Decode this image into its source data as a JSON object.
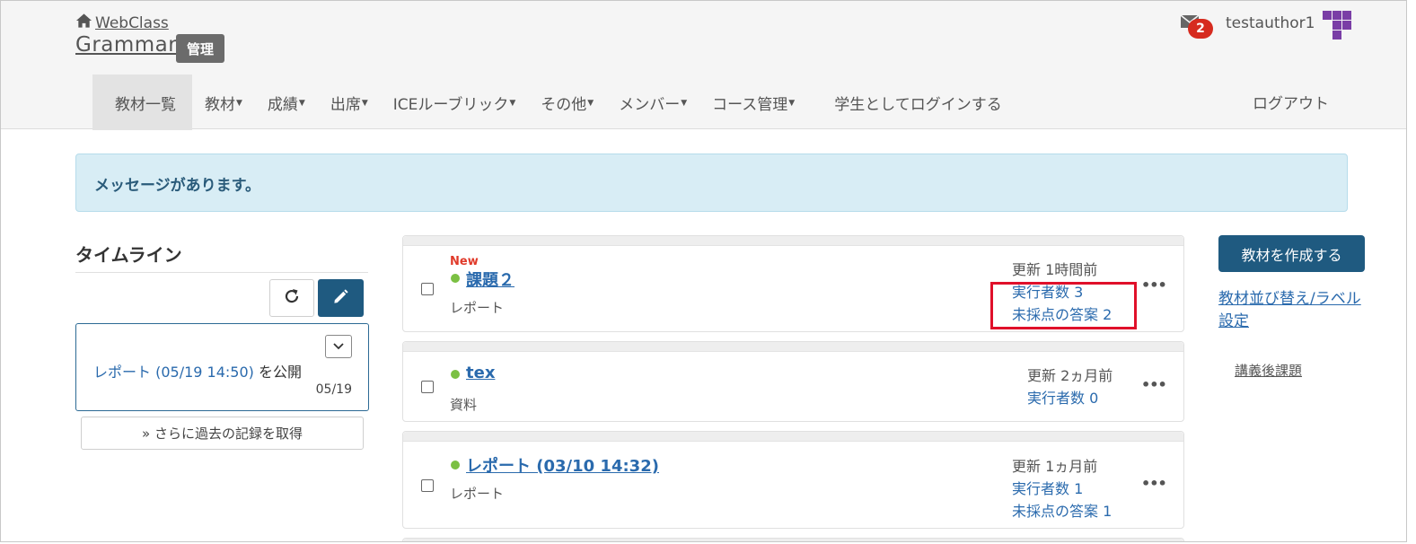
{
  "header": {
    "home_label": "WebClass",
    "course_title": "Grammar",
    "admin_badge": "管理",
    "mail_count": "2",
    "username": "testauthor1",
    "logout_label": "ログアウト"
  },
  "nav": {
    "items": [
      {
        "label": "教材一覧"
      },
      {
        "label": "教材"
      },
      {
        "label": "成績"
      },
      {
        "label": "出席"
      },
      {
        "label": "ICEルーブリック"
      },
      {
        "label": "その他"
      },
      {
        "label": "メンバー"
      },
      {
        "label": "コース管理"
      },
      {
        "label": "学生としてログインする"
      }
    ]
  },
  "alert": {
    "message": "メッセージがあります。"
  },
  "timeline": {
    "title": "タイムライン",
    "entry": {
      "link": "レポート (05/19 14:50)",
      "suffix": " を公開",
      "date": "05/19"
    },
    "more_label": "» さらに過去の記録を取得"
  },
  "materials": [
    {
      "new_label": "New",
      "title": "課題２",
      "type": "レポート",
      "updated": "更新 1時間前",
      "executors": "実行者数 3",
      "ungraded": "未採点の答案 2"
    },
    {
      "title": "tex",
      "type": "資料",
      "updated": "更新 2ヵ月前",
      "executors": "実行者数 0"
    },
    {
      "title": "レポート (03/10 14:32)",
      "type": "レポート",
      "updated": "更新 1ヵ月前",
      "executors": "実行者数 1",
      "ungraded": "未採点の答案 1"
    }
  ],
  "sidebar": {
    "create_label": "教材を作成する",
    "sort_label": "教材並び替え/ラベル設定",
    "tag_label": "講義後課題"
  },
  "icons": {
    "home": "home-icon",
    "mail": "mail-icon",
    "refresh": "refresh-icon",
    "edit": "pencil-icon",
    "toggle": "chevron-down-icon",
    "more": "more-horizontal-icon"
  },
  "colors": {
    "primary": "#1f5a80",
    "link": "#2a6aad",
    "alert_bg": "#d8edf5",
    "badge_red": "#d62b1f",
    "new_red": "#e03a2a",
    "status_green": "#7bc043",
    "highlight_red": "#e0102a",
    "avatar_purple": "#7a3ea6"
  }
}
